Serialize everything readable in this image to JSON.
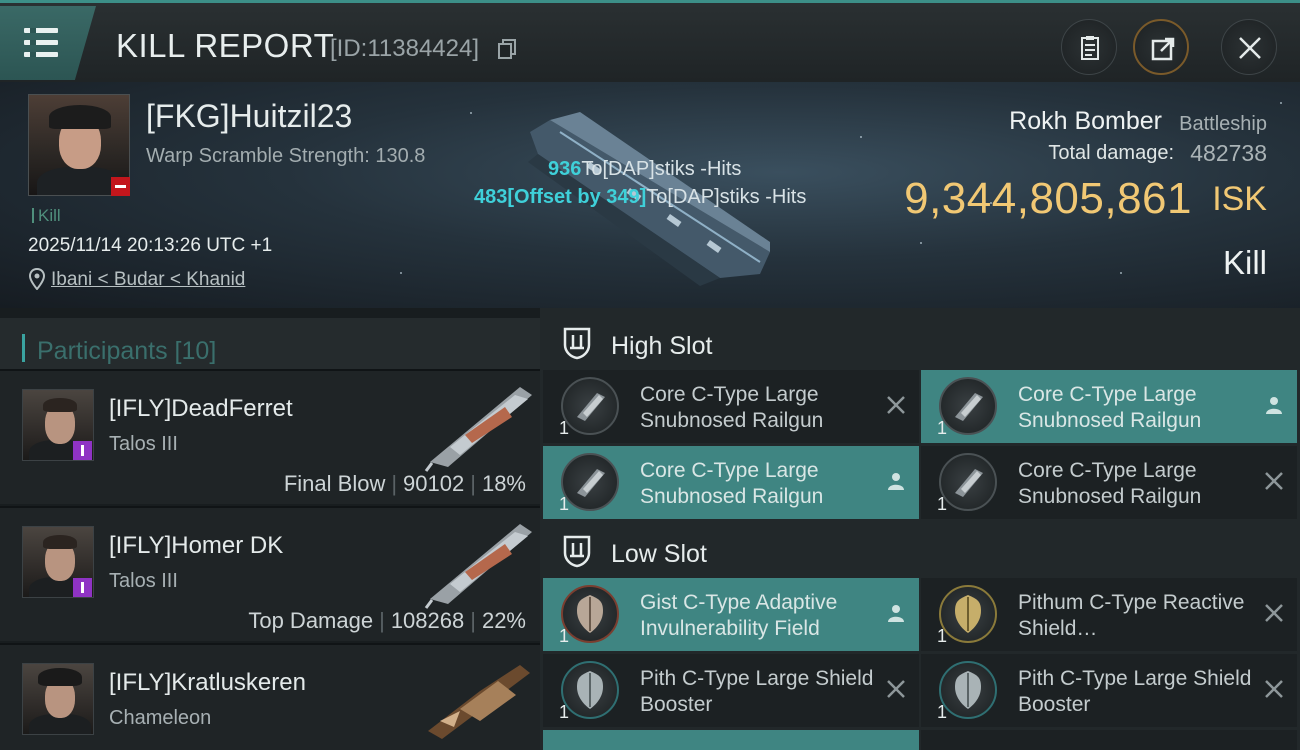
{
  "header": {
    "title": "KILL REPORT",
    "report_id": "[ID:11384424]"
  },
  "victim": {
    "name": "[FKG]Huitzil23",
    "warp_scramble": "Warp Scramble Strength: 130.8",
    "kill_tag": "Kill",
    "datetime": "2025/11/14 20:13:26 UTC +1",
    "location": "Ibani < Budar < Khanid",
    "ship_name": "Rokh Bomber",
    "ship_class": "Battleship",
    "total_damage_label": "Total damage:",
    "total_damage": "482738",
    "isk_value": "9,344,805,861",
    "isk_label": "ISK",
    "result": "Kill"
  },
  "hits": [
    {
      "value": "936",
      "text": "To[DAP]stiks -Hits"
    },
    {
      "value": "483[Offset by 349]",
      "text": "To[DAP]stiks -Hits"
    }
  ],
  "participants": {
    "header": "Participants [10]",
    "items": [
      {
        "name": "[IFLY]DeadFerret",
        "ship": "Talos III",
        "role": "Final Blow",
        "damage": "90102",
        "percent": "18%"
      },
      {
        "name": "[IFLY]Homer DK",
        "ship": "Talos III",
        "role": "Top Damage",
        "damage": "108268",
        "percent": "22%"
      },
      {
        "name": "[IFLY]Kratluskeren",
        "ship": "Chameleon",
        "role": "",
        "damage": "",
        "percent": ""
      }
    ]
  },
  "slots": {
    "high": {
      "label": "High Slot",
      "modules": [
        {
          "name": "Core C-Type Large Snubnosed Railgun",
          "qty": "1",
          "status": "destroyed",
          "highlight": false
        },
        {
          "name": "Core C-Type Large Snubnosed Railgun",
          "qty": "1",
          "status": "dropped",
          "highlight": true
        },
        {
          "name": "Core C-Type Large Snubnosed Railgun",
          "qty": "1",
          "status": "dropped",
          "highlight": true
        },
        {
          "name": "Core C-Type Large Snubnosed Railgun",
          "qty": "1",
          "status": "destroyed",
          "highlight": false
        }
      ]
    },
    "low": {
      "label": "Low Slot",
      "modules": [
        {
          "name": "Gist C-Type Adaptive Invulnerability Field",
          "qty": "1",
          "status": "dropped",
          "highlight": true
        },
        {
          "name": "Pithum C-Type Reactive Shield…",
          "qty": "1",
          "status": "destroyed",
          "highlight": false
        },
        {
          "name": "Pith C-Type Large Shield Booster",
          "qty": "1",
          "status": "destroyed",
          "highlight": false
        },
        {
          "name": "Pith C-Type Large Shield Booster",
          "qty": "1",
          "status": "destroyed",
          "highlight": false
        }
      ]
    }
  },
  "colors": {
    "accent": "#3f8582",
    "isk": "#f1c874",
    "hits": "#3fd0d9",
    "kill_badge": "#c3161c",
    "corp_badge": "#8f33c4"
  },
  "icons": {
    "menu": "menu-icon",
    "copy": "copy-icon",
    "clipboard": "clipboard-icon",
    "share": "share-icon",
    "close": "close-icon",
    "location": "location-pin-icon",
    "high_slot": "high-slot-icon",
    "low_slot": "low-slot-icon",
    "dropped": "person-icon",
    "destroyed": "x-icon"
  }
}
